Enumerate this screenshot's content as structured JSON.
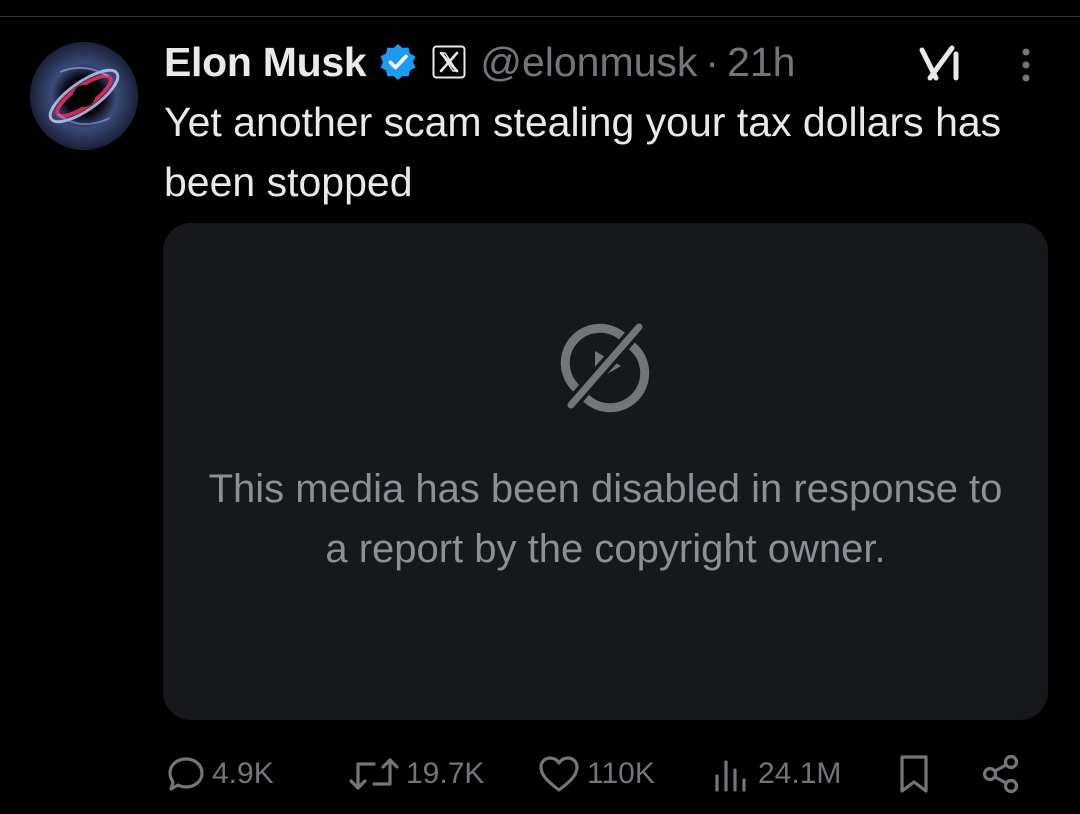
{
  "tweet": {
    "author_name": "Elon Musk",
    "handle": "@elonmusk",
    "separator": "·",
    "time": "21h",
    "text": "Yet another scam stealing your tax dollars has been stopped"
  },
  "media": {
    "message": "This media has been disabled in response to a report by the copyright owner."
  },
  "actions": {
    "replies": "4.9K",
    "reposts": "19.7K",
    "likes": "110K",
    "views": "24.1M"
  },
  "colors": {
    "background": "#000000",
    "text": "#e7e9ea",
    "muted": "#71767b",
    "verified_blue": "#1d9bf0",
    "card": "#16181c"
  },
  "icons": {
    "verified": "verified-badge-icon",
    "x_badge": "x-logo-icon",
    "grok": "grok-icon",
    "more": "more-vertical-icon",
    "media_disabled": "media-disabled-icon",
    "reply": "reply-icon",
    "repost": "repost-icon",
    "like": "heart-icon",
    "views": "views-bar-icon",
    "bookmark": "bookmark-icon",
    "share": "share-icon"
  }
}
